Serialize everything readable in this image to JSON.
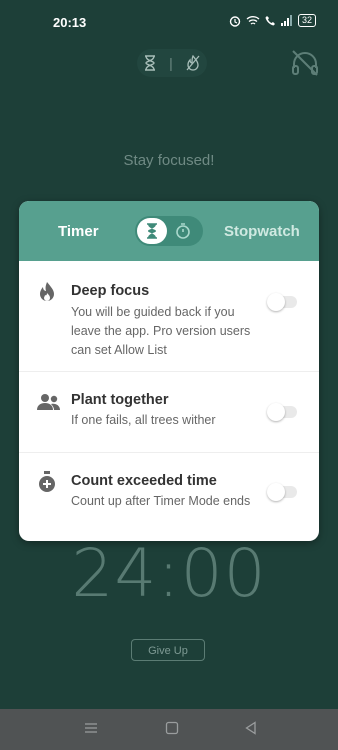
{
  "status_bar": {
    "time": "20:13",
    "battery": "32"
  },
  "screen": {
    "message": "Stay focused!",
    "timer": "24:00",
    "give_up_label": "Give Up"
  },
  "mode_card": {
    "tabs": {
      "left": "Timer",
      "right": "Stopwatch"
    },
    "options": [
      {
        "title": "Deep focus",
        "desc": "You will be guided back if you leave the app. Pro version users can set Allow List",
        "icon": "flame-icon",
        "enabled": false
      },
      {
        "title": "Plant together",
        "desc": "If one fails, all trees wither",
        "icon": "people-icon",
        "enabled": false
      },
      {
        "title": "Count exceeded time",
        "desc": "Count up after Timer Mode ends",
        "icon": "stopwatch-icon",
        "enabled": false
      }
    ]
  },
  "colors": {
    "background": "#1d3f38",
    "card_header": "#57a08f",
    "accent": "#3f8a79"
  }
}
